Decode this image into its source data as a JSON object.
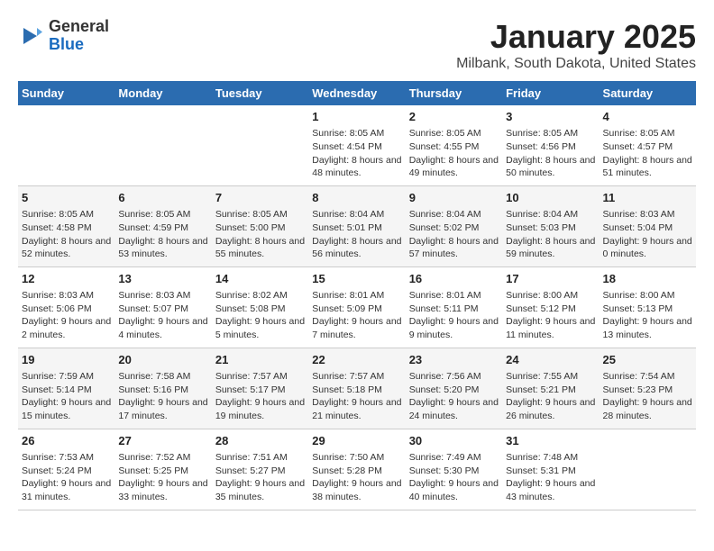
{
  "header": {
    "logo": {
      "general": "General",
      "blue": "Blue"
    },
    "title": "January 2025",
    "subtitle": "Milbank, South Dakota, United States"
  },
  "days_of_week": [
    "Sunday",
    "Monday",
    "Tuesday",
    "Wednesday",
    "Thursday",
    "Friday",
    "Saturday"
  ],
  "weeks": [
    [
      {
        "day": "",
        "info": ""
      },
      {
        "day": "",
        "info": ""
      },
      {
        "day": "",
        "info": ""
      },
      {
        "day": "1",
        "info": "Sunrise: 8:05 AM\nSunset: 4:54 PM\nDaylight: 8 hours and 48 minutes."
      },
      {
        "day": "2",
        "info": "Sunrise: 8:05 AM\nSunset: 4:55 PM\nDaylight: 8 hours and 49 minutes."
      },
      {
        "day": "3",
        "info": "Sunrise: 8:05 AM\nSunset: 4:56 PM\nDaylight: 8 hours and 50 minutes."
      },
      {
        "day": "4",
        "info": "Sunrise: 8:05 AM\nSunset: 4:57 PM\nDaylight: 8 hours and 51 minutes."
      }
    ],
    [
      {
        "day": "5",
        "info": "Sunrise: 8:05 AM\nSunset: 4:58 PM\nDaylight: 8 hours and 52 minutes."
      },
      {
        "day": "6",
        "info": "Sunrise: 8:05 AM\nSunset: 4:59 PM\nDaylight: 8 hours and 53 minutes."
      },
      {
        "day": "7",
        "info": "Sunrise: 8:05 AM\nSunset: 5:00 PM\nDaylight: 8 hours and 55 minutes."
      },
      {
        "day": "8",
        "info": "Sunrise: 8:04 AM\nSunset: 5:01 PM\nDaylight: 8 hours and 56 minutes."
      },
      {
        "day": "9",
        "info": "Sunrise: 8:04 AM\nSunset: 5:02 PM\nDaylight: 8 hours and 57 minutes."
      },
      {
        "day": "10",
        "info": "Sunrise: 8:04 AM\nSunset: 5:03 PM\nDaylight: 8 hours and 59 minutes."
      },
      {
        "day": "11",
        "info": "Sunrise: 8:03 AM\nSunset: 5:04 PM\nDaylight: 9 hours and 0 minutes."
      }
    ],
    [
      {
        "day": "12",
        "info": "Sunrise: 8:03 AM\nSunset: 5:06 PM\nDaylight: 9 hours and 2 minutes."
      },
      {
        "day": "13",
        "info": "Sunrise: 8:03 AM\nSunset: 5:07 PM\nDaylight: 9 hours and 4 minutes."
      },
      {
        "day": "14",
        "info": "Sunrise: 8:02 AM\nSunset: 5:08 PM\nDaylight: 9 hours and 5 minutes."
      },
      {
        "day": "15",
        "info": "Sunrise: 8:01 AM\nSunset: 5:09 PM\nDaylight: 9 hours and 7 minutes."
      },
      {
        "day": "16",
        "info": "Sunrise: 8:01 AM\nSunset: 5:11 PM\nDaylight: 9 hours and 9 minutes."
      },
      {
        "day": "17",
        "info": "Sunrise: 8:00 AM\nSunset: 5:12 PM\nDaylight: 9 hours and 11 minutes."
      },
      {
        "day": "18",
        "info": "Sunrise: 8:00 AM\nSunset: 5:13 PM\nDaylight: 9 hours and 13 minutes."
      }
    ],
    [
      {
        "day": "19",
        "info": "Sunrise: 7:59 AM\nSunset: 5:14 PM\nDaylight: 9 hours and 15 minutes."
      },
      {
        "day": "20",
        "info": "Sunrise: 7:58 AM\nSunset: 5:16 PM\nDaylight: 9 hours and 17 minutes."
      },
      {
        "day": "21",
        "info": "Sunrise: 7:57 AM\nSunset: 5:17 PM\nDaylight: 9 hours and 19 minutes."
      },
      {
        "day": "22",
        "info": "Sunrise: 7:57 AM\nSunset: 5:18 PM\nDaylight: 9 hours and 21 minutes."
      },
      {
        "day": "23",
        "info": "Sunrise: 7:56 AM\nSunset: 5:20 PM\nDaylight: 9 hours and 24 minutes."
      },
      {
        "day": "24",
        "info": "Sunrise: 7:55 AM\nSunset: 5:21 PM\nDaylight: 9 hours and 26 minutes."
      },
      {
        "day": "25",
        "info": "Sunrise: 7:54 AM\nSunset: 5:23 PM\nDaylight: 9 hours and 28 minutes."
      }
    ],
    [
      {
        "day": "26",
        "info": "Sunrise: 7:53 AM\nSunset: 5:24 PM\nDaylight: 9 hours and 31 minutes."
      },
      {
        "day": "27",
        "info": "Sunrise: 7:52 AM\nSunset: 5:25 PM\nDaylight: 9 hours and 33 minutes."
      },
      {
        "day": "28",
        "info": "Sunrise: 7:51 AM\nSunset: 5:27 PM\nDaylight: 9 hours and 35 minutes."
      },
      {
        "day": "29",
        "info": "Sunrise: 7:50 AM\nSunset: 5:28 PM\nDaylight: 9 hours and 38 minutes."
      },
      {
        "day": "30",
        "info": "Sunrise: 7:49 AM\nSunset: 5:30 PM\nDaylight: 9 hours and 40 minutes."
      },
      {
        "day": "31",
        "info": "Sunrise: 7:48 AM\nSunset: 5:31 PM\nDaylight: 9 hours and 43 minutes."
      },
      {
        "day": "",
        "info": ""
      }
    ]
  ]
}
